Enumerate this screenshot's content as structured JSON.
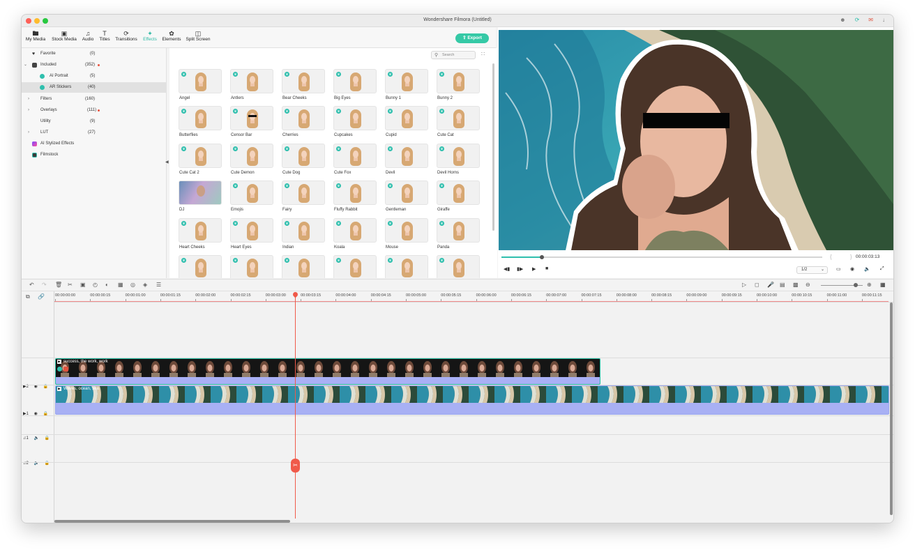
{
  "window": {
    "title": "Wondershare Filmora (Untitled)"
  },
  "titlebar_icons": [
    "account-icon",
    "sync-icon",
    "mail-icon",
    "download-icon"
  ],
  "nav": {
    "tabs": [
      {
        "label": "My Media",
        "icon": "folder-icon"
      },
      {
        "label": "Stock Media",
        "icon": "stock-icon"
      },
      {
        "label": "Audio",
        "icon": "music-note-icon"
      },
      {
        "label": "Titles",
        "icon": "text-icon"
      },
      {
        "label": "Transitions",
        "icon": "transition-icon"
      },
      {
        "label": "Effects",
        "icon": "effects-icon",
        "active": true
      },
      {
        "label": "Elements",
        "icon": "elements-icon"
      },
      {
        "label": "Split Screen",
        "icon": "split-screen-icon"
      }
    ],
    "export_label": "Export"
  },
  "sidebar": {
    "items": [
      {
        "label": "Favorite",
        "count": "(0)",
        "icon": "heart-icon"
      },
      {
        "label": "Included",
        "count": "(352)",
        "icon": "grid-icon",
        "dot": true,
        "expanded": true
      },
      {
        "label": "AI Portrait",
        "count": "(5)",
        "icon": "crown-icon"
      },
      {
        "label": "AR Stickers",
        "count": "(40)",
        "icon": "crown-icon",
        "selected": true
      },
      {
        "label": "Filters",
        "count": "(160)"
      },
      {
        "label": "Overlays",
        "count": "(111)",
        "dot": true
      },
      {
        "label": "Utility",
        "count": "(9)"
      },
      {
        "label": "LUT",
        "count": "(27)"
      },
      {
        "label": "AI Stylized Effects",
        "count": "",
        "icon": "ai-style-icon"
      },
      {
        "label": "Filmstock",
        "count": "",
        "icon": "filmstock-icon"
      }
    ]
  },
  "effects": {
    "search_placeholder": "Search",
    "items": [
      "Angel",
      "Antlers",
      "Bear Cheeks",
      "Big Eyes",
      "Bunny 1",
      "Bunny 2",
      "Butterflies",
      "Censor Bar",
      "Cherries",
      "Cupcakes",
      "Cupid",
      "Cute Cat",
      "Cute Cat 2",
      "Cute Demon",
      "Cute Dog",
      "Cute Fox",
      "Devil",
      "Devil Horns",
      "DJ",
      "Emojis",
      "Fairy",
      "Fluffy Rabbit",
      "Gentleman",
      "Giraffe",
      "Heart Cheeks",
      "Heart Eyes",
      "Indian",
      "Koala",
      "Mouse",
      "Panda",
      "",
      "",
      "",
      "",
      "",
      ""
    ]
  },
  "preview": {
    "timecode": "00:00:03:13",
    "progress": 0.125,
    "ratio": "1/2",
    "marks": "{ }"
  },
  "timeline": {
    "ticks": [
      "00:00:00:00",
      "00:00:00:15",
      "00:00:01:00",
      "00:00:01:15",
      "00:00:02:00",
      "00:00:02:15",
      "00:00:03:00",
      "00:00:03:15",
      "00:00:04:00",
      "00:00:04:15",
      "00:00:05:00",
      "00:00:05:15",
      "00:00:06:00",
      "00:00:06:15",
      "00:00:07:00",
      "00:00:07:15",
      "00:00:08:00",
      "00:00:08:15",
      "00:00:09:00",
      "00:00:09:15",
      "00:00:10:00",
      "00:00:10:15",
      "00:00:11:00",
      "00:00:11:15"
    ],
    "tracks": [
      {
        "label": "2",
        "type": "video"
      },
      {
        "label": "1",
        "type": "video"
      },
      {
        "label": "1",
        "type": "audio"
      },
      {
        "label": "2",
        "type": "audio"
      }
    ],
    "clip_top": "success, the work, work",
    "clip_bottom": "Waves, ocean, sea"
  }
}
